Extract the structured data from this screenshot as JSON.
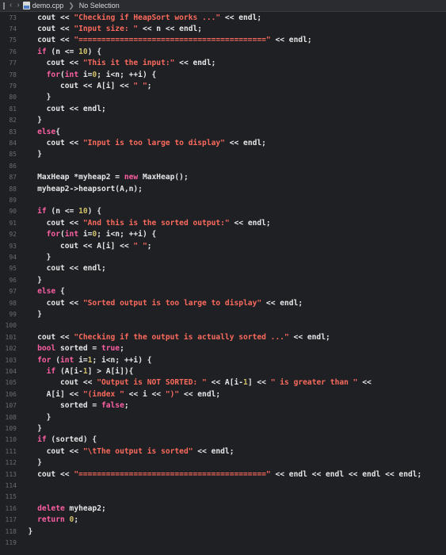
{
  "topbar": {
    "filename": "demo.cpp",
    "selection": "No Selection"
  },
  "lines": [
    {
      "n": "73",
      "t": [
        [
          "p",
          "    cout << "
        ],
        [
          "s",
          "\"Checking if HeapSort works ...\""
        ],
        [
          "p",
          " << endl;"
        ]
      ]
    },
    {
      "n": "74",
      "t": [
        [
          "p",
          "    cout << "
        ],
        [
          "s",
          "\"Input size: \""
        ],
        [
          "p",
          " << n << endl;"
        ]
      ]
    },
    {
      "n": "75",
      "t": [
        [
          "p",
          "    cout << "
        ],
        [
          "s",
          "\"=========================================\""
        ],
        [
          "p",
          " << endl;"
        ]
      ]
    },
    {
      "n": "76",
      "t": [
        [
          "k",
          "    if"
        ],
        [
          "p",
          " (n <= "
        ],
        [
          "n",
          "10"
        ],
        [
          "p",
          ") {"
        ]
      ]
    },
    {
      "n": "77",
      "t": [
        [
          "p",
          "      cout << "
        ],
        [
          "s",
          "\"This it the input:\""
        ],
        [
          "p",
          " << endl;"
        ]
      ]
    },
    {
      "n": "78",
      "t": [
        [
          "k",
          "      for"
        ],
        [
          "p",
          "("
        ],
        [
          "k",
          "int"
        ],
        [
          "p",
          " i="
        ],
        [
          "n",
          "0"
        ],
        [
          "p",
          "; i<n; ++i) {"
        ]
      ]
    },
    {
      "n": "79",
      "t": [
        [
          "p",
          "         cout << A[i] << "
        ],
        [
          "s",
          "\" \""
        ],
        [
          "p",
          ";"
        ]
      ]
    },
    {
      "n": "80",
      "t": [
        [
          "p",
          "      }"
        ]
      ]
    },
    {
      "n": "81",
      "t": [
        [
          "p",
          "      cout << endl;"
        ]
      ]
    },
    {
      "n": "82",
      "t": [
        [
          "p",
          "    }"
        ]
      ]
    },
    {
      "n": "83",
      "t": [
        [
          "k",
          "    else"
        ],
        [
          "p",
          "{"
        ]
      ]
    },
    {
      "n": "84",
      "t": [
        [
          "p",
          "      cout << "
        ],
        [
          "s",
          "\"Input is too large to display\""
        ],
        [
          "p",
          " << endl;"
        ]
      ]
    },
    {
      "n": "85",
      "t": [
        [
          "p",
          "    }"
        ]
      ]
    },
    {
      "n": "86",
      "t": [
        [
          "p",
          ""
        ]
      ]
    },
    {
      "n": "87",
      "t": [
        [
          "p",
          "    MaxHeap *myheap2 = "
        ],
        [
          "k",
          "new"
        ],
        [
          "p",
          " MaxHeap();"
        ]
      ]
    },
    {
      "n": "88",
      "t": [
        [
          "p",
          "    myheap2->heapsort(A,n);"
        ]
      ]
    },
    {
      "n": "89",
      "t": [
        [
          "p",
          ""
        ]
      ]
    },
    {
      "n": "90",
      "t": [
        [
          "k",
          "    if"
        ],
        [
          "p",
          " (n <= "
        ],
        [
          "n",
          "10"
        ],
        [
          "p",
          ") {"
        ]
      ]
    },
    {
      "n": "91",
      "t": [
        [
          "p",
          "      cout << "
        ],
        [
          "s",
          "\"And this is the sorted output:\""
        ],
        [
          "p",
          " << endl;"
        ]
      ]
    },
    {
      "n": "92",
      "t": [
        [
          "k",
          "      for"
        ],
        [
          "p",
          "("
        ],
        [
          "k",
          "int"
        ],
        [
          "p",
          " i="
        ],
        [
          "n",
          "0"
        ],
        [
          "p",
          "; i<n; ++i) {"
        ]
      ]
    },
    {
      "n": "93",
      "t": [
        [
          "p",
          "         cout << A[i] << "
        ],
        [
          "s",
          "\" \""
        ],
        [
          "p",
          ";"
        ]
      ]
    },
    {
      "n": "94",
      "t": [
        [
          "p",
          "      }"
        ]
      ]
    },
    {
      "n": "95",
      "t": [
        [
          "p",
          "      cout << endl;"
        ]
      ]
    },
    {
      "n": "96",
      "t": [
        [
          "p",
          "    }"
        ]
      ]
    },
    {
      "n": "97",
      "t": [
        [
          "k",
          "    else"
        ],
        [
          "p",
          " {"
        ]
      ]
    },
    {
      "n": "98",
      "t": [
        [
          "p",
          "      cout << "
        ],
        [
          "s",
          "\"Sorted output is too large to display\""
        ],
        [
          "p",
          " << endl;"
        ]
      ]
    },
    {
      "n": "99",
      "t": [
        [
          "p",
          "    }"
        ]
      ]
    },
    {
      "n": "100",
      "t": [
        [
          "p",
          ""
        ]
      ]
    },
    {
      "n": "101",
      "t": [
        [
          "p",
          "    cout << "
        ],
        [
          "s",
          "\"Checking if the output is actually sorted ...\""
        ],
        [
          "p",
          " << endl;"
        ]
      ]
    },
    {
      "n": "102",
      "t": [
        [
          "k",
          "    bool"
        ],
        [
          "p",
          " sorted = "
        ],
        [
          "k",
          "true"
        ],
        [
          "p",
          ";"
        ]
      ]
    },
    {
      "n": "103",
      "t": [
        [
          "k",
          "    for"
        ],
        [
          "p",
          " ("
        ],
        [
          "k",
          "int"
        ],
        [
          "p",
          " i="
        ],
        [
          "n",
          "1"
        ],
        [
          "p",
          "; i<n; ++i) {"
        ]
      ]
    },
    {
      "n": "104",
      "t": [
        [
          "k",
          "      if"
        ],
        [
          "p",
          " (A[i-"
        ],
        [
          "n",
          "1"
        ],
        [
          "p",
          "] > A[i]){"
        ]
      ]
    },
    {
      "n": "105",
      "t": [
        [
          "p",
          "         cout << "
        ],
        [
          "s",
          "\"Output is NOT SORTED: \""
        ],
        [
          "p",
          " << A[i-"
        ],
        [
          "n",
          "1"
        ],
        [
          "p",
          "] << "
        ],
        [
          "s",
          "\" is greater than \""
        ],
        [
          "p",
          " <<"
        ]
      ]
    },
    {
      "n": "106",
      "t": [
        [
          "p",
          "      A[i] << "
        ],
        [
          "s",
          "\"(index \""
        ],
        [
          "p",
          " << i << "
        ],
        [
          "s",
          "\")\""
        ],
        [
          "p",
          " << endl;"
        ]
      ]
    },
    {
      "n": "107",
      "t": [
        [
          "p",
          "         sorted = "
        ],
        [
          "k",
          "false"
        ],
        [
          "p",
          ";"
        ]
      ]
    },
    {
      "n": "108",
      "t": [
        [
          "p",
          "      }"
        ]
      ]
    },
    {
      "n": "109",
      "t": [
        [
          "p",
          "    }"
        ]
      ]
    },
    {
      "n": "110",
      "t": [
        [
          "k",
          "    if"
        ],
        [
          "p",
          " (sorted) {"
        ]
      ]
    },
    {
      "n": "111",
      "t": [
        [
          "p",
          "      cout << "
        ],
        [
          "s",
          "\"\\tThe output is sorted\""
        ],
        [
          "p",
          " << endl;"
        ]
      ]
    },
    {
      "n": "112",
      "t": [
        [
          "p",
          "    }"
        ]
      ]
    },
    {
      "n": "113",
      "t": [
        [
          "p",
          "    cout << "
        ],
        [
          "s",
          "\"=========================================\""
        ],
        [
          "p",
          " << endl << endl << endl << endl;"
        ]
      ]
    },
    {
      "n": "114",
      "t": [
        [
          "p",
          ""
        ]
      ]
    },
    {
      "n": "115",
      "t": [
        [
          "p",
          ""
        ]
      ]
    },
    {
      "n": "116",
      "t": [
        [
          "k",
          "    delete"
        ],
        [
          "p",
          " myheap2;"
        ]
      ]
    },
    {
      "n": "117",
      "t": [
        [
          "k",
          "    return"
        ],
        [
          "p",
          " "
        ],
        [
          "n",
          "0"
        ],
        [
          "p",
          ";"
        ]
      ]
    },
    {
      "n": "118",
      "t": [
        [
          "p",
          "  }"
        ]
      ]
    },
    {
      "n": "119",
      "t": [
        [
          "p",
          ""
        ]
      ]
    }
  ],
  "colors": {
    "background": "#1f2024",
    "keyword": "#fc5fa3",
    "string": "#fc6a5d",
    "number": "#d0bf69",
    "text": "#e6e6e6",
    "line_number": "#6c6c70"
  }
}
